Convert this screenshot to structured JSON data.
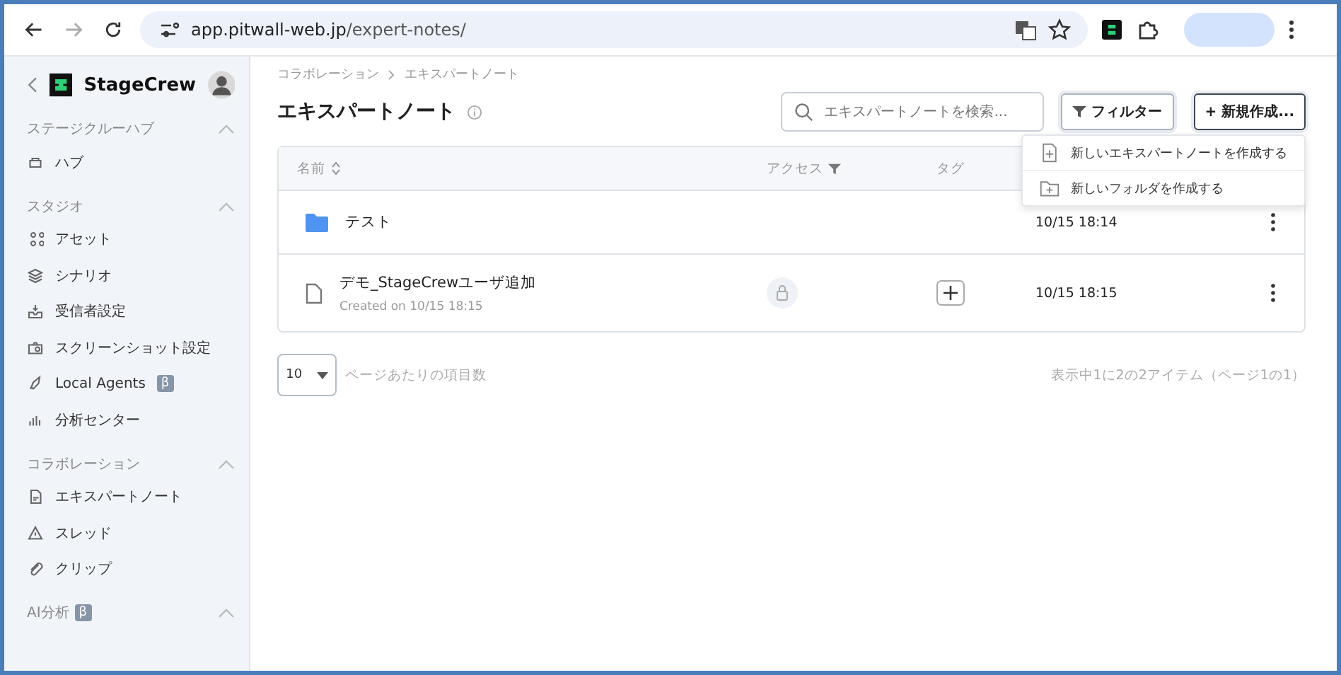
{
  "browser": {
    "url_host": "app.pitwall-web.jp",
    "url_path": "/expert-notes/"
  },
  "sidebar": {
    "brand": "StageCrew",
    "groups": [
      {
        "title": "ステージクルーハブ",
        "expanded": true,
        "items": [
          {
            "label": "ハブ"
          }
        ]
      },
      {
        "title": "スタジオ",
        "expanded": true,
        "items": [
          {
            "label": "アセット"
          },
          {
            "label": "シナリオ"
          },
          {
            "label": "受信者設定"
          },
          {
            "label": "スクリーンショット設定"
          },
          {
            "label": "Local Agents",
            "badge": "β"
          },
          {
            "label": "分析センター"
          }
        ]
      },
      {
        "title": "コラボレーション",
        "expanded": true,
        "items": [
          {
            "label": "エキスパートノート"
          },
          {
            "label": "スレッド"
          },
          {
            "label": "クリップ"
          }
        ]
      },
      {
        "title": "AI分析",
        "badge": "β",
        "expanded": true
      }
    ]
  },
  "breadcrumb": [
    "コラボレーション",
    "エキスパートノート"
  ],
  "page_title": "エキスパートノート",
  "search": {
    "placeholder": "エキスパートノートを検索..."
  },
  "filter_button": "フィルター",
  "new_button": "+ 新規作成...",
  "new_menu": [
    "新しいエキスパートノートを作成する",
    "新しいフォルダを作成する"
  ],
  "table": {
    "columns": [
      "名前",
      "アクセス",
      "タグ"
    ],
    "rows": [
      {
        "kind": "folder",
        "name": "テスト",
        "date": "10/15 18:14"
      },
      {
        "kind": "file",
        "name": "デモ_StageCrewユーザ追加",
        "created": "Created on 10/15 18:15",
        "date": "10/15 18:15"
      }
    ]
  },
  "pagination": {
    "per_page": "10",
    "per_page_label": "ページあたりの項目数",
    "summary": "表示中1に2の2アイテム（ページ1の1）"
  }
}
